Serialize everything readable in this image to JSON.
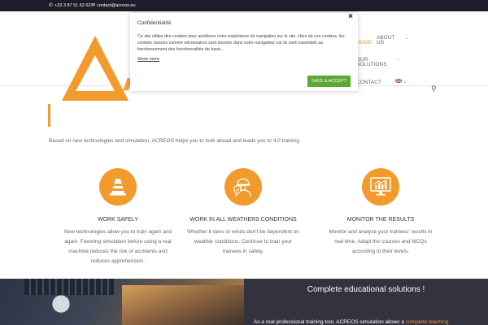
{
  "topbar": {
    "phone": "+33 3 87 51 62 62",
    "email": "contact@acreos.eu",
    "phone_icon": "phone-icon",
    "email_icon": "envelope-icon"
  },
  "nav": {
    "items": [
      {
        "label": "HOME",
        "active": true
      },
      {
        "label": "ABOUT",
        "label2": "US"
      },
      {
        "label": "OUR",
        "label2": "SOLUTIONS"
      },
      {
        "label": "CONTACT"
      }
    ],
    "language_icon": "uk-flag-icon"
  },
  "hero": {
    "title": "ACREOS"
  },
  "intro": "Based on new technologies and simulation, ACREOS helps you to look ahead and leads you to 4.0 training.",
  "features": [
    {
      "icon": "traffic-cone-icon",
      "title": "WORK SAFELY",
      "text": "New technologies allow you to train again and again. Favoring simulation before using a real machine reduces the risk of accidents and reduces apprehension."
    },
    {
      "icon": "worker-shield-icon",
      "title": "WORK IN ALL WEATHERS CONDITIONS",
      "text": "Whether it rains or winds don't be dependent on weather conditions. Continue to train your trainees in safety."
    },
    {
      "icon": "monitor-chart-icon",
      "title": "MONITOR THE RESULTS",
      "text": "Monitor and analyze your trainees' results in real time. Adapt the courses and MCQs according to their levels."
    }
  ],
  "bottom": {
    "heading": "Complete educational solutions !",
    "text_start": "As a real professional training tool, ACREOS simulation allows a",
    "text_highlight": "complete teaching"
  },
  "cookie": {
    "title": "Confidentialité",
    "body": "Ce site utilise des cookies pour améliorer votre expérience de navigation sur le site. Hors de ces cookies, les cookies classés comme nécessaires sont stockés dans votre navigateur car ils sont essentiels au fonctionnement des fonctionnalités de base...",
    "show_more": "Show more",
    "accept": "SAVE & ACCEPT",
    "close": "×"
  },
  "colors": {
    "accent": "#f39a2d",
    "topbar": "#1d1d2a",
    "panel": "#33323f",
    "accept": "#5aa836"
  }
}
